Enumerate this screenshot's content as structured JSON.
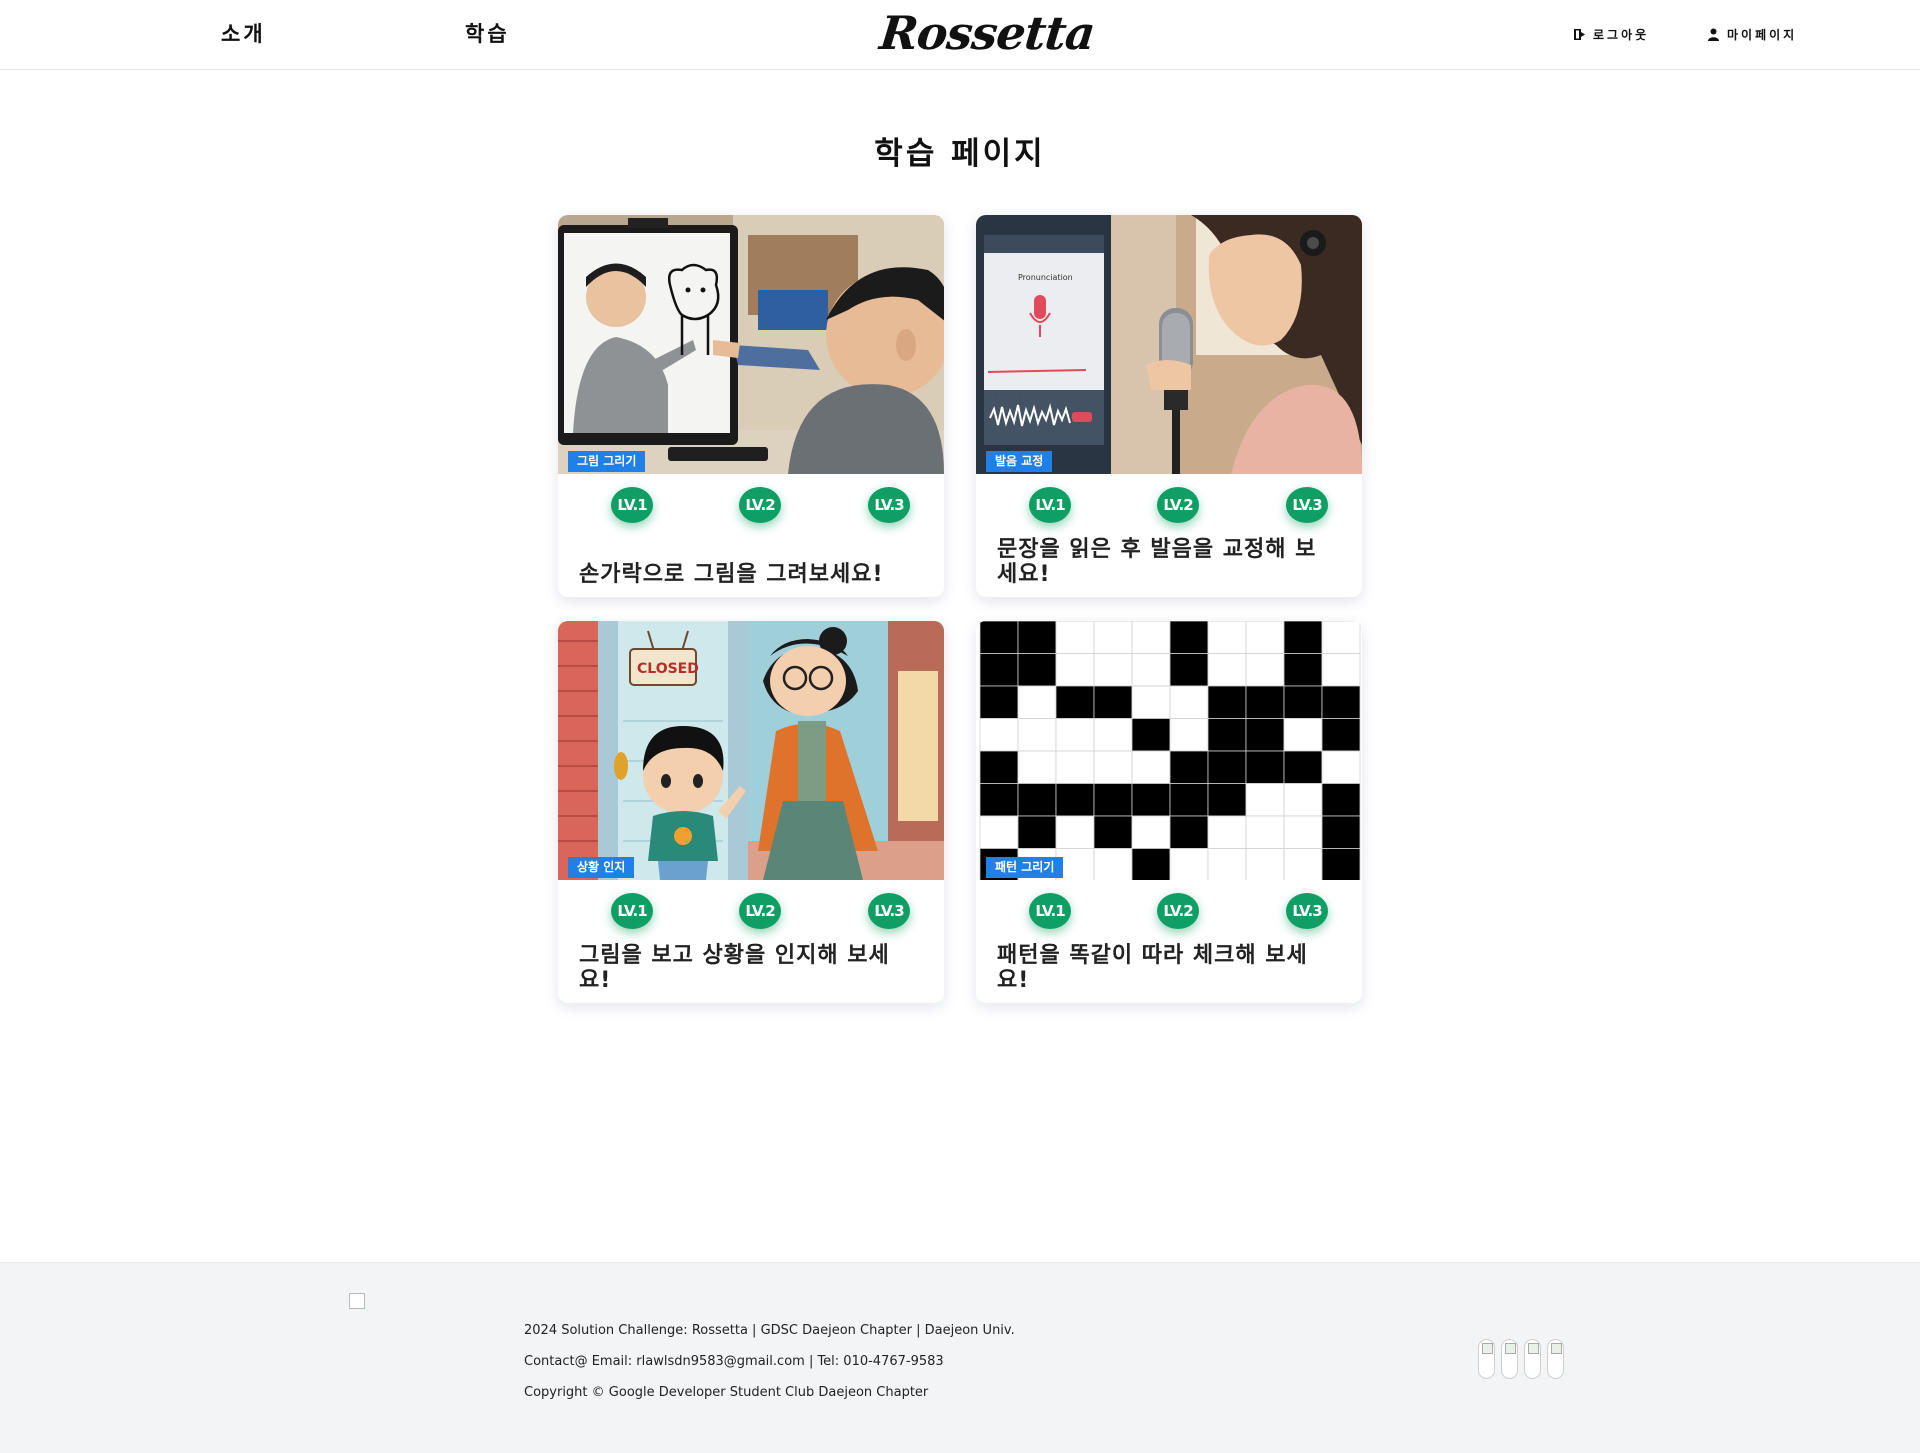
{
  "header": {
    "nav": [
      {
        "label": "소개"
      },
      {
        "label": "학습"
      }
    ],
    "logo_text": "Rossetta",
    "logout_label": "로그아웃",
    "mypage_label": "마이페이지"
  },
  "page_title": "학습 페이지",
  "cards": [
    {
      "tag": "그림 그리기",
      "title": "손가락으로 그림을 그려보세요!",
      "levels": [
        "LV.1",
        "LV.2",
        "LV.3"
      ]
    },
    {
      "tag": "발음 교정",
      "title": "문장을 읽은 후 발음을 교정해 보세요!",
      "levels": [
        "LV.1",
        "LV.2",
        "LV.3"
      ]
    },
    {
      "tag": "상황 인지",
      "title": "그림을 보고 상황을 인지해 보세요!",
      "levels": [
        "LV.1",
        "LV.2",
        "LV.3"
      ]
    },
    {
      "tag": "패턴 그리기",
      "title": "패턴을 똑같이 따라 체크해 보세요!",
      "levels": [
        "LV.1",
        "LV.2",
        "LV.3"
      ]
    }
  ],
  "image_text": {
    "pronunciation_screen": "Pronunciation",
    "closed_sign": "CLOSED"
  },
  "footer": {
    "line1": "2024 Solution Challenge: Rossetta | GDSC Daejeon Chapter | Daejeon Univ.",
    "line2": "Contact@ Email: rlawlsdn9583@gmail.com | Tel: 010-4767-9583",
    "line3": "Copyright © Google Developer Student Club Daejeon Chapter"
  },
  "colors": {
    "tag_blue": "#1f80e8",
    "level_green": "#0f9e63",
    "footer_bg": "#f3f4f6"
  }
}
